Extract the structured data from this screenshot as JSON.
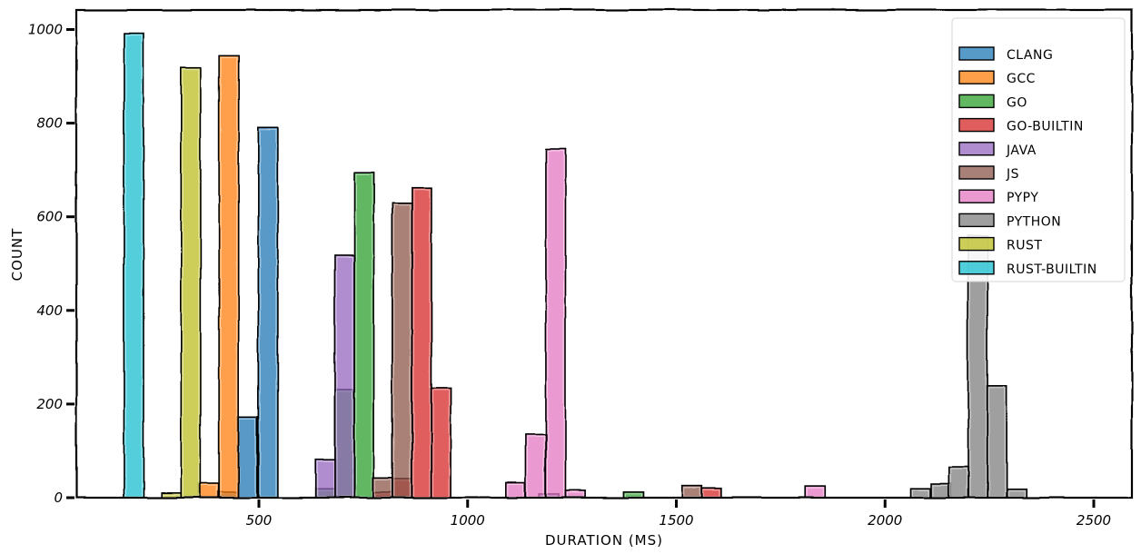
{
  "chart_data": {
    "type": "bar",
    "style": "xkcd-histogram-overlapping",
    "title": "",
    "xlabel": "DURATION (MS)",
    "ylabel": "COUNT",
    "xlim": [
      100,
      2600
    ],
    "ylim": [
      0,
      1040
    ],
    "xticks": [
      500,
      1000,
      1500,
      2000,
      2500
    ],
    "xtick_labels": [
      "500",
      "1000",
      "1500",
      "2000",
      "2500"
    ],
    "yticks": [
      0,
      200,
      400,
      600,
      800,
      1000
    ],
    "ytick_labels": [
      "0",
      "200",
      "400",
      "600",
      "800",
      "1000"
    ],
    "bin_width_ms": 47,
    "grid": false,
    "legend_position": "top-right",
    "series": [
      {
        "name": "CLANG",
        "color": "#1f77b4",
        "bins": [
          [
            425,
            12
          ],
          [
            472,
            172
          ],
          [
            522,
            790
          ],
          [
            1195,
            8
          ]
        ]
      },
      {
        "name": "GCC",
        "color": "#ff7f0e",
        "bins": [
          [
            380,
            30
          ],
          [
            428,
            945
          ]
        ]
      },
      {
        "name": "GO",
        "color": "#2ca02c",
        "bins": [
          [
            660,
            18
          ],
          [
            705,
            230
          ],
          [
            752,
            695
          ],
          [
            1397,
            12
          ]
        ]
      },
      {
        "name": "GO-BUILTIN",
        "color": "#d62728",
        "bins": [
          [
            797,
            12
          ],
          [
            843,
            40
          ],
          [
            890,
            662
          ],
          [
            936,
            233
          ],
          [
            1584,
            20
          ]
        ]
      },
      {
        "name": "JAVA",
        "color": "#9467bd",
        "bins": [
          [
            660,
            82
          ],
          [
            705,
            518
          ]
        ]
      },
      {
        "name": "JS",
        "color": "#8c564b",
        "bins": [
          [
            797,
            42
          ],
          [
            843,
            628
          ],
          [
            1538,
            25
          ]
        ]
      },
      {
        "name": "PYPY",
        "color": "#e377c2",
        "bins": [
          [
            1115,
            32
          ],
          [
            1163,
            135
          ],
          [
            1211,
            745
          ],
          [
            1258,
            15
          ],
          [
            1833,
            25
          ]
        ]
      },
      {
        "name": "PYTHON",
        "color": "#7f7f7f",
        "bins": [
          [
            2085,
            20
          ],
          [
            2134,
            30
          ],
          [
            2176,
            65
          ],
          [
            2222,
            560
          ],
          [
            2268,
            238
          ],
          [
            2316,
            18
          ]
        ]
      },
      {
        "name": "RUST",
        "color": "#bcbd22",
        "bins": [
          [
            290,
            10
          ],
          [
            337,
            920
          ]
        ]
      },
      {
        "name": "RUST-BUILTIN",
        "color": "#17becf",
        "bins": [
          [
            200,
            992
          ]
        ]
      }
    ]
  }
}
